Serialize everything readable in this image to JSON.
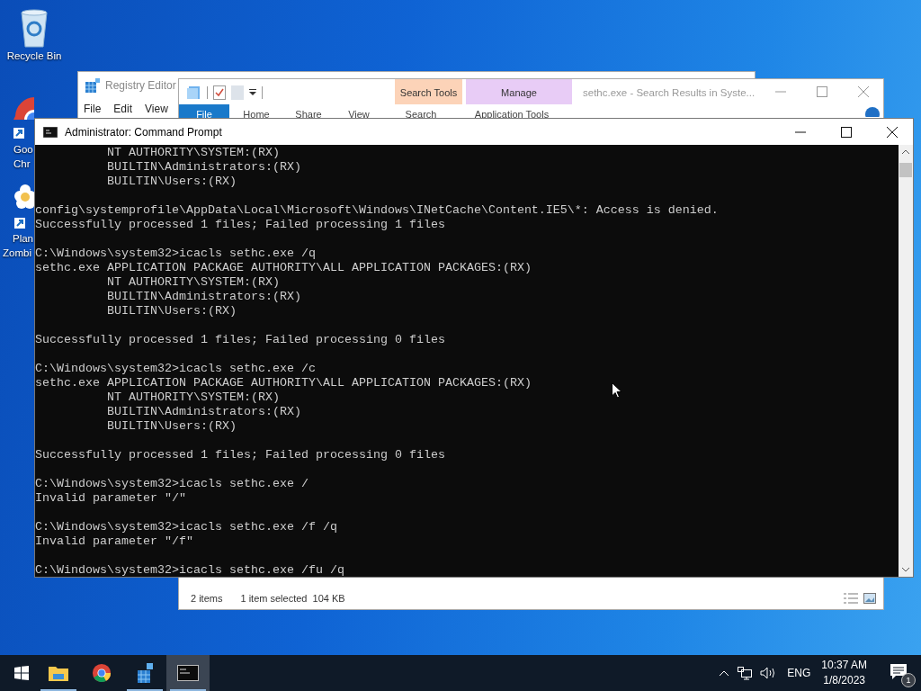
{
  "desktop_icons": [
    {
      "kind": "recycle-bin",
      "label_lines": [
        "Recycle Bin"
      ]
    },
    {
      "kind": "chrome",
      "label_lines": [
        "Goo",
        "Chr"
      ]
    },
    {
      "kind": "flower",
      "label_lines": [
        "Plan",
        "Zombi"
      ]
    }
  ],
  "registry_editor": {
    "title": "Registry Editor",
    "menu": [
      "File",
      "Edit",
      "View"
    ]
  },
  "explorer": {
    "title": "sethc.exe - Search Results in Syste...",
    "context_tabs": [
      {
        "label": "Search Tools",
        "color": "#fcd3b8"
      },
      {
        "label": "Manage",
        "color": "#e8ccf6"
      }
    ],
    "ribbon_tabs": [
      {
        "label": "File",
        "selected": true
      },
      {
        "label": "Home",
        "selected": false
      },
      {
        "label": "Share",
        "selected": false
      },
      {
        "label": "View",
        "selected": false
      },
      {
        "label": "Search",
        "selected": false
      },
      {
        "label": "Application Tools",
        "selected": false
      }
    ],
    "status_bar": {
      "items": "2 items",
      "selection": "1 item selected  104 KB"
    }
  },
  "command_prompt": {
    "title": "Administrator: Command Prompt",
    "blocks": [
      [
        "          NT AUTHORITY\\SYSTEM:(RX)",
        "          BUILTIN\\Administrators:(RX)",
        "          BUILTIN\\Users:(RX)"
      ],
      [
        "config\\systemprofile\\AppData\\Local\\Microsoft\\Windows\\INetCache\\Content.IE5\\*: Access is denied.",
        "Successfully processed 1 files; Failed processing 1 files"
      ],
      [
        "C:\\Windows\\system32>icacls sethc.exe /q",
        "sethc.exe APPLICATION PACKAGE AUTHORITY\\ALL APPLICATION PACKAGES:(RX)",
        "          NT AUTHORITY\\SYSTEM:(RX)",
        "          BUILTIN\\Administrators:(RX)",
        "          BUILTIN\\Users:(RX)"
      ],
      [
        "Successfully processed 1 files; Failed processing 0 files"
      ],
      [
        "C:\\Windows\\system32>icacls sethc.exe /c",
        "sethc.exe APPLICATION PACKAGE AUTHORITY\\ALL APPLICATION PACKAGES:(RX)",
        "          NT AUTHORITY\\SYSTEM:(RX)",
        "          BUILTIN\\Administrators:(RX)",
        "          BUILTIN\\Users:(RX)"
      ],
      [
        "Successfully processed 1 files; Failed processing 0 files"
      ],
      [
        "C:\\Windows\\system32>icacls sethc.exe /",
        "Invalid parameter \"/\""
      ],
      [
        "C:\\Windows\\system32>icacls sethc.exe /f /q",
        "Invalid parameter \"/f\""
      ],
      [
        "C:\\Windows\\system32>icacls sethc.exe /fu /q"
      ]
    ]
  },
  "taskbar": {
    "apps": [
      {
        "kind": "folder",
        "active": false
      },
      {
        "kind": "chrome",
        "active": false
      },
      {
        "kind": "cubes",
        "active": false
      },
      {
        "kind": "console",
        "active": true
      }
    ],
    "tray": {
      "language": "ENG",
      "time": "10:37 AM",
      "date": "1/8/2023",
      "notifications": "1"
    }
  }
}
